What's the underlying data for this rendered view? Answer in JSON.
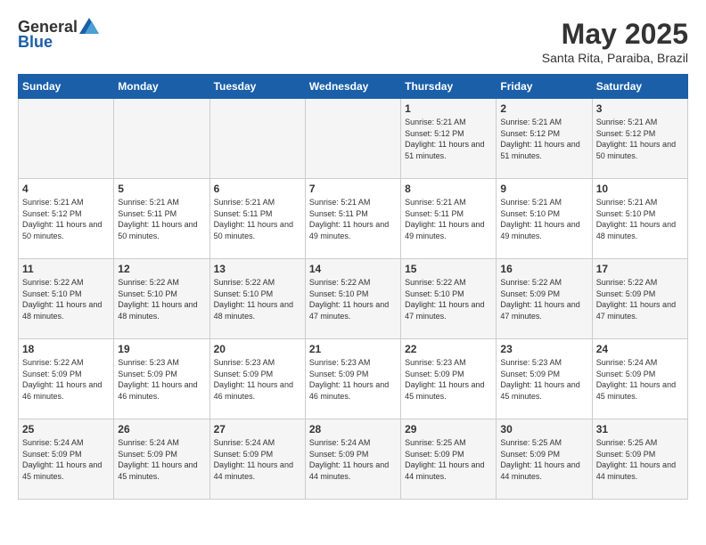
{
  "logo": {
    "text_general": "General",
    "text_blue": "Blue"
  },
  "header": {
    "title": "May 2025",
    "subtitle": "Santa Rita, Paraiba, Brazil"
  },
  "weekdays": [
    "Sunday",
    "Monday",
    "Tuesday",
    "Wednesday",
    "Thursday",
    "Friday",
    "Saturday"
  ],
  "weeks": [
    [
      {
        "day": "",
        "info": ""
      },
      {
        "day": "",
        "info": ""
      },
      {
        "day": "",
        "info": ""
      },
      {
        "day": "",
        "info": ""
      },
      {
        "day": "1",
        "info": "Sunrise: 5:21 AM\nSunset: 5:12 PM\nDaylight: 11 hours and 51 minutes."
      },
      {
        "day": "2",
        "info": "Sunrise: 5:21 AM\nSunset: 5:12 PM\nDaylight: 11 hours and 51 minutes."
      },
      {
        "day": "3",
        "info": "Sunrise: 5:21 AM\nSunset: 5:12 PM\nDaylight: 11 hours and 50 minutes."
      }
    ],
    [
      {
        "day": "4",
        "info": "Sunrise: 5:21 AM\nSunset: 5:12 PM\nDaylight: 11 hours and 50 minutes."
      },
      {
        "day": "5",
        "info": "Sunrise: 5:21 AM\nSunset: 5:11 PM\nDaylight: 11 hours and 50 minutes."
      },
      {
        "day": "6",
        "info": "Sunrise: 5:21 AM\nSunset: 5:11 PM\nDaylight: 11 hours and 50 minutes."
      },
      {
        "day": "7",
        "info": "Sunrise: 5:21 AM\nSunset: 5:11 PM\nDaylight: 11 hours and 49 minutes."
      },
      {
        "day": "8",
        "info": "Sunrise: 5:21 AM\nSunset: 5:11 PM\nDaylight: 11 hours and 49 minutes."
      },
      {
        "day": "9",
        "info": "Sunrise: 5:21 AM\nSunset: 5:10 PM\nDaylight: 11 hours and 49 minutes."
      },
      {
        "day": "10",
        "info": "Sunrise: 5:21 AM\nSunset: 5:10 PM\nDaylight: 11 hours and 48 minutes."
      }
    ],
    [
      {
        "day": "11",
        "info": "Sunrise: 5:22 AM\nSunset: 5:10 PM\nDaylight: 11 hours and 48 minutes."
      },
      {
        "day": "12",
        "info": "Sunrise: 5:22 AM\nSunset: 5:10 PM\nDaylight: 11 hours and 48 minutes."
      },
      {
        "day": "13",
        "info": "Sunrise: 5:22 AM\nSunset: 5:10 PM\nDaylight: 11 hours and 48 minutes."
      },
      {
        "day": "14",
        "info": "Sunrise: 5:22 AM\nSunset: 5:10 PM\nDaylight: 11 hours and 47 minutes."
      },
      {
        "day": "15",
        "info": "Sunrise: 5:22 AM\nSunset: 5:10 PM\nDaylight: 11 hours and 47 minutes."
      },
      {
        "day": "16",
        "info": "Sunrise: 5:22 AM\nSunset: 5:09 PM\nDaylight: 11 hours and 47 minutes."
      },
      {
        "day": "17",
        "info": "Sunrise: 5:22 AM\nSunset: 5:09 PM\nDaylight: 11 hours and 47 minutes."
      }
    ],
    [
      {
        "day": "18",
        "info": "Sunrise: 5:22 AM\nSunset: 5:09 PM\nDaylight: 11 hours and 46 minutes."
      },
      {
        "day": "19",
        "info": "Sunrise: 5:23 AM\nSunset: 5:09 PM\nDaylight: 11 hours and 46 minutes."
      },
      {
        "day": "20",
        "info": "Sunrise: 5:23 AM\nSunset: 5:09 PM\nDaylight: 11 hours and 46 minutes."
      },
      {
        "day": "21",
        "info": "Sunrise: 5:23 AM\nSunset: 5:09 PM\nDaylight: 11 hours and 46 minutes."
      },
      {
        "day": "22",
        "info": "Sunrise: 5:23 AM\nSunset: 5:09 PM\nDaylight: 11 hours and 45 minutes."
      },
      {
        "day": "23",
        "info": "Sunrise: 5:23 AM\nSunset: 5:09 PM\nDaylight: 11 hours and 45 minutes."
      },
      {
        "day": "24",
        "info": "Sunrise: 5:24 AM\nSunset: 5:09 PM\nDaylight: 11 hours and 45 minutes."
      }
    ],
    [
      {
        "day": "25",
        "info": "Sunrise: 5:24 AM\nSunset: 5:09 PM\nDaylight: 11 hours and 45 minutes."
      },
      {
        "day": "26",
        "info": "Sunrise: 5:24 AM\nSunset: 5:09 PM\nDaylight: 11 hours and 45 minutes."
      },
      {
        "day": "27",
        "info": "Sunrise: 5:24 AM\nSunset: 5:09 PM\nDaylight: 11 hours and 44 minutes."
      },
      {
        "day": "28",
        "info": "Sunrise: 5:24 AM\nSunset: 5:09 PM\nDaylight: 11 hours and 44 minutes."
      },
      {
        "day": "29",
        "info": "Sunrise: 5:25 AM\nSunset: 5:09 PM\nDaylight: 11 hours and 44 minutes."
      },
      {
        "day": "30",
        "info": "Sunrise: 5:25 AM\nSunset: 5:09 PM\nDaylight: 11 hours and 44 minutes."
      },
      {
        "day": "31",
        "info": "Sunrise: 5:25 AM\nSunset: 5:09 PM\nDaylight: 11 hours and 44 minutes."
      }
    ]
  ]
}
